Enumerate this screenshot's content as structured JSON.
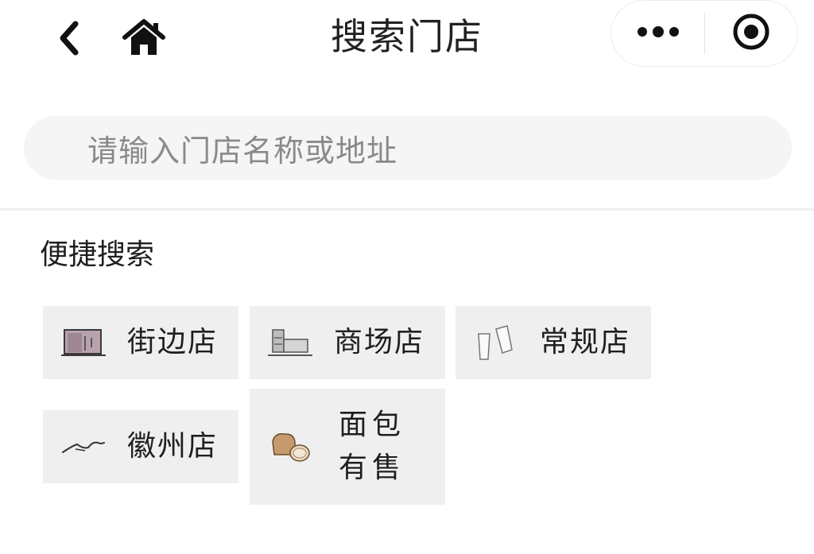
{
  "nav": {
    "title": "搜索门店",
    "back_icon": "chevron-left-icon",
    "home_icon": "home-icon",
    "more_icon": "more-dots-icon",
    "close_icon": "target-close-icon"
  },
  "search": {
    "placeholder": "请输入门店名称或地址"
  },
  "quick_search": {
    "title": "便捷搜索",
    "items": [
      {
        "label": "街边店",
        "icon": "storefront-icon"
      },
      {
        "label": "商场店",
        "icon": "mall-building-icon"
      },
      {
        "label": "常规店",
        "icon": "cups-icon"
      },
      {
        "label": "徽州店",
        "icon": "mountain-roof-icon"
      },
      {
        "label": "面包有售",
        "icon": "bread-icon"
      }
    ]
  }
}
